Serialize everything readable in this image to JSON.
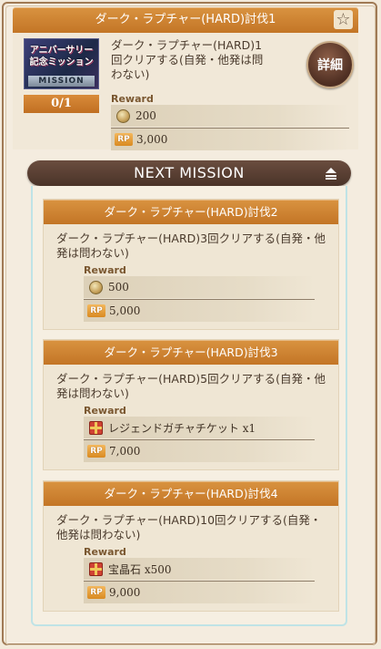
{
  "current": {
    "title": "ダーク・ラプチャー(HARD)討伐1",
    "logo_line1": "アニバーサリー",
    "logo_line2": "記念ミッション",
    "logo_mission": "MISSION",
    "progress": "0/1",
    "description": "ダーク・ラプチャー(HARD)1回クリアする(自発・他発は問わない)",
    "detail_label": "詳細",
    "reward_label": "Reward",
    "rewards": [
      {
        "icon": "crystal-icon",
        "text": "200"
      },
      {
        "icon": "rp-icon",
        "text": "3,000"
      }
    ]
  },
  "rp_badge": "RP",
  "next_mission_label": "NEXT MISSION",
  "next": [
    {
      "title": "ダーク・ラプチャー(HARD)討伐2",
      "description": "ダーク・ラプチャー(HARD)3回クリアする(自発・他発は問わない)",
      "reward_label": "Reward",
      "rewards": [
        {
          "icon": "crystal-icon",
          "text": "500"
        },
        {
          "icon": "rp-icon",
          "text": "5,000"
        }
      ]
    },
    {
      "title": "ダーク・ラプチャー(HARD)討伐3",
      "description": "ダーク・ラプチャー(HARD)5回クリアする(自発・他発は問わない)",
      "reward_label": "Reward",
      "rewards": [
        {
          "icon": "gift-icon",
          "text": "レジェンドガチャチケット x1"
        },
        {
          "icon": "rp-icon",
          "text": "7,000"
        }
      ]
    },
    {
      "title": "ダーク・ラプチャー(HARD)討伐4",
      "description": "ダーク・ラプチャー(HARD)10回クリアする(自発・他発は問わない)",
      "reward_label": "Reward",
      "rewards": [
        {
          "icon": "gift-icon",
          "text": "宝晶石 x500"
        },
        {
          "icon": "rp-icon",
          "text": "9,000"
        }
      ]
    }
  ]
}
